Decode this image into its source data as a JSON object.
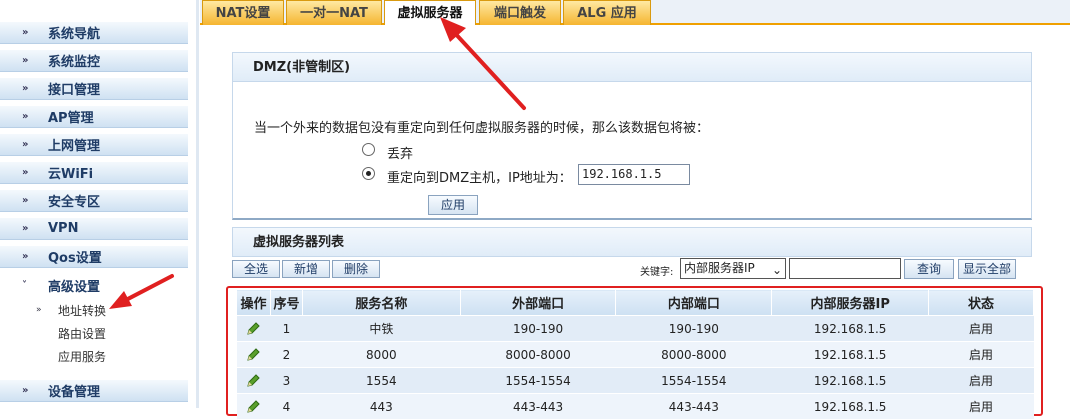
{
  "sidebar": {
    "items": [
      {
        "label": "系统导航"
      },
      {
        "label": "系统监控"
      },
      {
        "label": "接口管理"
      },
      {
        "label": "AP管理"
      },
      {
        "label": "上网管理"
      },
      {
        "label": "云WiFi"
      },
      {
        "label": "安全专区"
      },
      {
        "label": "VPN"
      },
      {
        "label": "Qos设置"
      },
      {
        "label": "高级设置"
      },
      {
        "label": "设备管理"
      }
    ],
    "sub_items": [
      {
        "label": "地址转换"
      },
      {
        "label": "路由设置"
      },
      {
        "label": "应用服务"
      }
    ]
  },
  "tabs": [
    {
      "label": "NAT设置"
    },
    {
      "label": "一对一NAT"
    },
    {
      "label": "虚拟服务器"
    },
    {
      "label": "端口触发"
    },
    {
      "label": "ALG 应用"
    }
  ],
  "dmz": {
    "title": "DMZ(非管制区)",
    "description": "当一个外来的数据包没有重定向到任何虚拟服务器的时候，那么该数据包将被：",
    "option_drop": "丢弃",
    "option_redirect": "重定向到DMZ主机，IP地址为：",
    "ip_value": "192.168.1.5",
    "apply_label": "应用"
  },
  "vs": {
    "title": "虚拟服务器列表",
    "select_all": "全选",
    "add": "新增",
    "delete": "删除",
    "keyword_label": "关键字:",
    "keyword_value": "内部服务器IP",
    "search": "查询",
    "show_all": "显示全部",
    "columns": [
      "操作",
      "序号",
      "服务名称",
      "外部端口",
      "内部端口",
      "内部服务器IP",
      "状态"
    ],
    "rows": [
      {
        "no": "1",
        "name": "中铁",
        "ext": "190-190",
        "int": "190-190",
        "ip": "192.168.1.5",
        "status": "启用"
      },
      {
        "no": "2",
        "name": "8000",
        "ext": "8000-8000",
        "int": "8000-8000",
        "ip": "192.168.1.5",
        "status": "启用"
      },
      {
        "no": "3",
        "name": "1554",
        "ext": "1554-1554",
        "int": "1554-1554",
        "ip": "192.168.1.5",
        "status": "启用"
      },
      {
        "no": "4",
        "name": "443",
        "ext": "443-443",
        "int": "443-443",
        "ip": "192.168.1.5",
        "status": "启用"
      }
    ]
  },
  "colors": {
    "tab_active_border": "#f0a000",
    "highlight_red": "#e02020",
    "accent_text": "#1f3c66"
  }
}
